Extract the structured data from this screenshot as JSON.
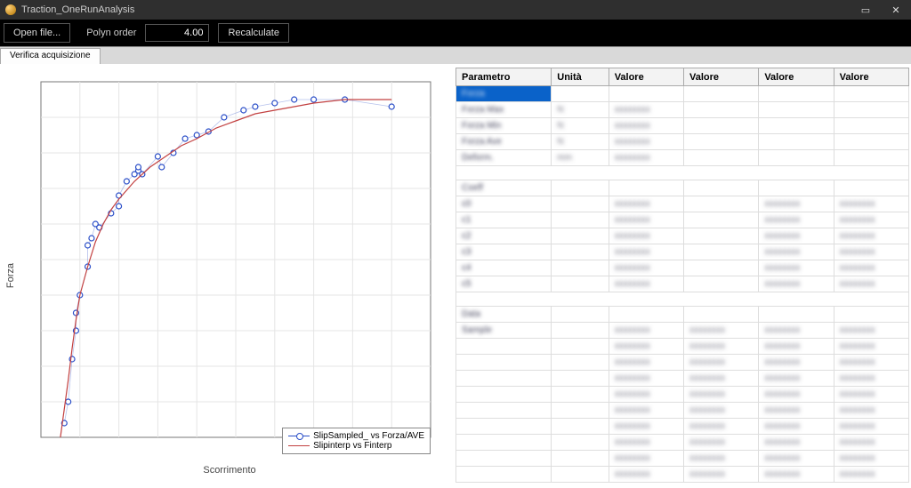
{
  "window": {
    "title": "Traction_OneRunAnalysis",
    "minimize_glyph": "▭",
    "close_glyph": "✕"
  },
  "toolbar": {
    "open_label": "Open file...",
    "polyn_label": "Polyn order",
    "polyn_value": "4.00",
    "recalc_label": "Recalculate"
  },
  "tab_label": "Verifica acquisizione",
  "chart_data": {
    "type": "scatter+line",
    "xlabel": "Scorrimento",
    "ylabel": "Forza",
    "xlim": [
      0,
      100
    ],
    "ylim": [
      0,
      100
    ],
    "series": [
      {
        "name": "SlipSampled_ vs Forza/AVE",
        "style": "points-blue",
        "points": [
          [
            6,
            4
          ],
          [
            7,
            10
          ],
          [
            8,
            22
          ],
          [
            9,
            30
          ],
          [
            9,
            35
          ],
          [
            10,
            40
          ],
          [
            12,
            48
          ],
          [
            12,
            54
          ],
          [
            13,
            56
          ],
          [
            14,
            60
          ],
          [
            15,
            59
          ],
          [
            18,
            63
          ],
          [
            20,
            65
          ],
          [
            20,
            68
          ],
          [
            22,
            72
          ],
          [
            24,
            74
          ],
          [
            25,
            75
          ],
          [
            25,
            76
          ],
          [
            26,
            74
          ],
          [
            30,
            79
          ],
          [
            31,
            76
          ],
          [
            34,
            80
          ],
          [
            37,
            84
          ],
          [
            40,
            85
          ],
          [
            43,
            86
          ],
          [
            47,
            90
          ],
          [
            52,
            92
          ],
          [
            55,
            93
          ],
          [
            60,
            94
          ],
          [
            65,
            95
          ],
          [
            70,
            95
          ],
          [
            78,
            95
          ],
          [
            90,
            93
          ]
        ]
      },
      {
        "name": "Slipinterp vs Finterp",
        "style": "line-red",
        "points": [
          [
            5,
            0
          ],
          [
            6,
            8
          ],
          [
            7,
            16
          ],
          [
            8,
            25
          ],
          [
            9,
            33
          ],
          [
            10,
            40
          ],
          [
            12,
            48
          ],
          [
            14,
            55
          ],
          [
            16,
            60
          ],
          [
            18,
            64
          ],
          [
            20,
            67
          ],
          [
            24,
            72
          ],
          [
            28,
            76
          ],
          [
            32,
            79
          ],
          [
            36,
            82
          ],
          [
            40,
            84
          ],
          [
            45,
            87
          ],
          [
            50,
            89
          ],
          [
            55,
            91
          ],
          [
            60,
            92
          ],
          [
            65,
            93
          ],
          [
            70,
            94
          ],
          [
            78,
            95
          ],
          [
            90,
            95
          ]
        ]
      }
    ]
  },
  "table": {
    "headers": [
      "Parametro",
      "Unità",
      "Valore",
      "Valore",
      "Valore",
      "Valore"
    ],
    "rows": [
      {
        "sel": true,
        "cells": [
          "Forza",
          "",
          "",
          "",
          "",
          ""
        ]
      },
      {
        "cells": [
          "Forza Max",
          "N",
          "xxxxxxxx",
          "",
          "",
          ""
        ]
      },
      {
        "cells": [
          "Forza Min",
          "N",
          "xxxxxxxx",
          "",
          "",
          ""
        ]
      },
      {
        "cells": [
          "Forza Ave",
          "N",
          "xxxxxxxx",
          "",
          "",
          ""
        ]
      },
      {
        "cells": [
          "Deform.",
          "mm",
          "xxxxxxxx",
          "",
          "",
          ""
        ]
      },
      {
        "spacer": true
      },
      {
        "cells": [
          "Coeff",
          "",
          "",
          "",
          "",
          ""
        ]
      },
      {
        "cells": [
          "c0",
          "",
          "xxxxxxxx",
          "",
          "xxxxxxxx",
          "xxxxxxxx"
        ]
      },
      {
        "cells": [
          "c1",
          "",
          "xxxxxxxx",
          "",
          "xxxxxxxx",
          "xxxxxxxx"
        ]
      },
      {
        "cells": [
          "c2",
          "",
          "xxxxxxxx",
          "",
          "xxxxxxxx",
          "xxxxxxxx"
        ]
      },
      {
        "cells": [
          "c3",
          "",
          "xxxxxxxx",
          "",
          "xxxxxxxx",
          "xxxxxxxx"
        ]
      },
      {
        "cells": [
          "c4",
          "",
          "xxxxxxxx",
          "",
          "xxxxxxxx",
          "xxxxxxxx"
        ]
      },
      {
        "cells": [
          "c5",
          "",
          "xxxxxxxx",
          "",
          "xxxxxxxx",
          "xxxxxxxx"
        ]
      },
      {
        "spacer": true
      },
      {
        "cells": [
          "Data",
          "",
          "",
          "",
          "",
          ""
        ]
      },
      {
        "cells": [
          "Sample",
          "",
          "xxxxxxxx",
          "xxxxxxxx",
          "xxxxxxxx",
          "xxxxxxxx"
        ]
      },
      {
        "cells": [
          "",
          "",
          "xxxxxxxx",
          "xxxxxxxx",
          "xxxxxxxx",
          "xxxxxxxx"
        ]
      },
      {
        "cells": [
          "",
          "",
          "xxxxxxxx",
          "xxxxxxxx",
          "xxxxxxxx",
          "xxxxxxxx"
        ]
      },
      {
        "cells": [
          "",
          "",
          "xxxxxxxx",
          "xxxxxxxx",
          "xxxxxxxx",
          "xxxxxxxx"
        ]
      },
      {
        "cells": [
          "",
          "",
          "xxxxxxxx",
          "xxxxxxxx",
          "xxxxxxxx",
          "xxxxxxxx"
        ]
      },
      {
        "cells": [
          "",
          "",
          "xxxxxxxx",
          "xxxxxxxx",
          "xxxxxxxx",
          "xxxxxxxx"
        ]
      },
      {
        "cells": [
          "",
          "",
          "xxxxxxxx",
          "xxxxxxxx",
          "xxxxxxxx",
          "xxxxxxxx"
        ]
      },
      {
        "cells": [
          "",
          "",
          "xxxxxxxx",
          "xxxxxxxx",
          "xxxxxxxx",
          "xxxxxxxx"
        ]
      },
      {
        "cells": [
          "",
          "",
          "xxxxxxxx",
          "xxxxxxxx",
          "xxxxxxxx",
          "xxxxxxxx"
        ]
      },
      {
        "cells": [
          "",
          "",
          "xxxxxxxx",
          "xxxxxxxx",
          "xxxxxxxx",
          "xxxxxxxx"
        ]
      }
    ]
  }
}
